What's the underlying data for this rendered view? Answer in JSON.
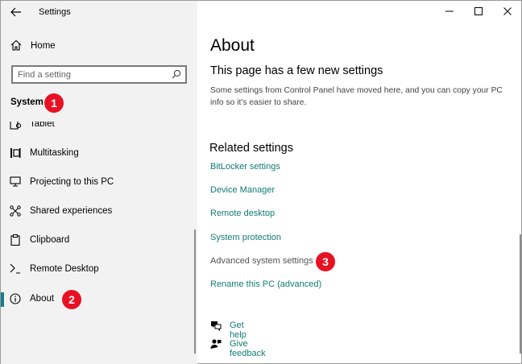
{
  "window": {
    "title": "Settings",
    "controls": [
      "minimize-icon",
      "maximize-icon",
      "close-icon"
    ]
  },
  "sidebar": {
    "home_label": "Home",
    "search_placeholder": "Find a setting",
    "section_title": "System",
    "items": [
      {
        "label": "Tablet",
        "icon": "tablet-icon"
      },
      {
        "label": "Multitasking",
        "icon": "multitasking-icon"
      },
      {
        "label": "Projecting to this PC",
        "icon": "projecting-icon"
      },
      {
        "label": "Shared experiences",
        "icon": "shared-experiences-icon"
      },
      {
        "label": "Clipboard",
        "icon": "clipboard-icon"
      },
      {
        "label": "Remote Desktop",
        "icon": "remote-desktop-icon"
      },
      {
        "label": "About",
        "icon": "info-icon",
        "selected": true
      }
    ]
  },
  "main": {
    "title": "About",
    "notice_title": "This page has a few new settings",
    "notice_text": "Some settings from Control Panel have moved here, and you can copy your PC info so it's easier to share.",
    "related_title": "Related settings",
    "links": [
      {
        "label": "BitLocker settings"
      },
      {
        "label": "Device Manager"
      },
      {
        "label": "Remote desktop"
      },
      {
        "label": "System protection"
      },
      {
        "label": "Advanced system settings"
      },
      {
        "label": "Rename this PC (advanced)"
      }
    ],
    "help": [
      {
        "label": "Get help",
        "icon": "get-help-icon"
      },
      {
        "label": "Give feedback",
        "icon": "feedback-icon"
      }
    ]
  },
  "badges": [
    "1",
    "2",
    "3"
  ],
  "colors": {
    "link": "#107c73",
    "badge": "#e81123",
    "sidebar_bg": "#f2f2f2",
    "selected_bar": "#1a7a8a"
  }
}
